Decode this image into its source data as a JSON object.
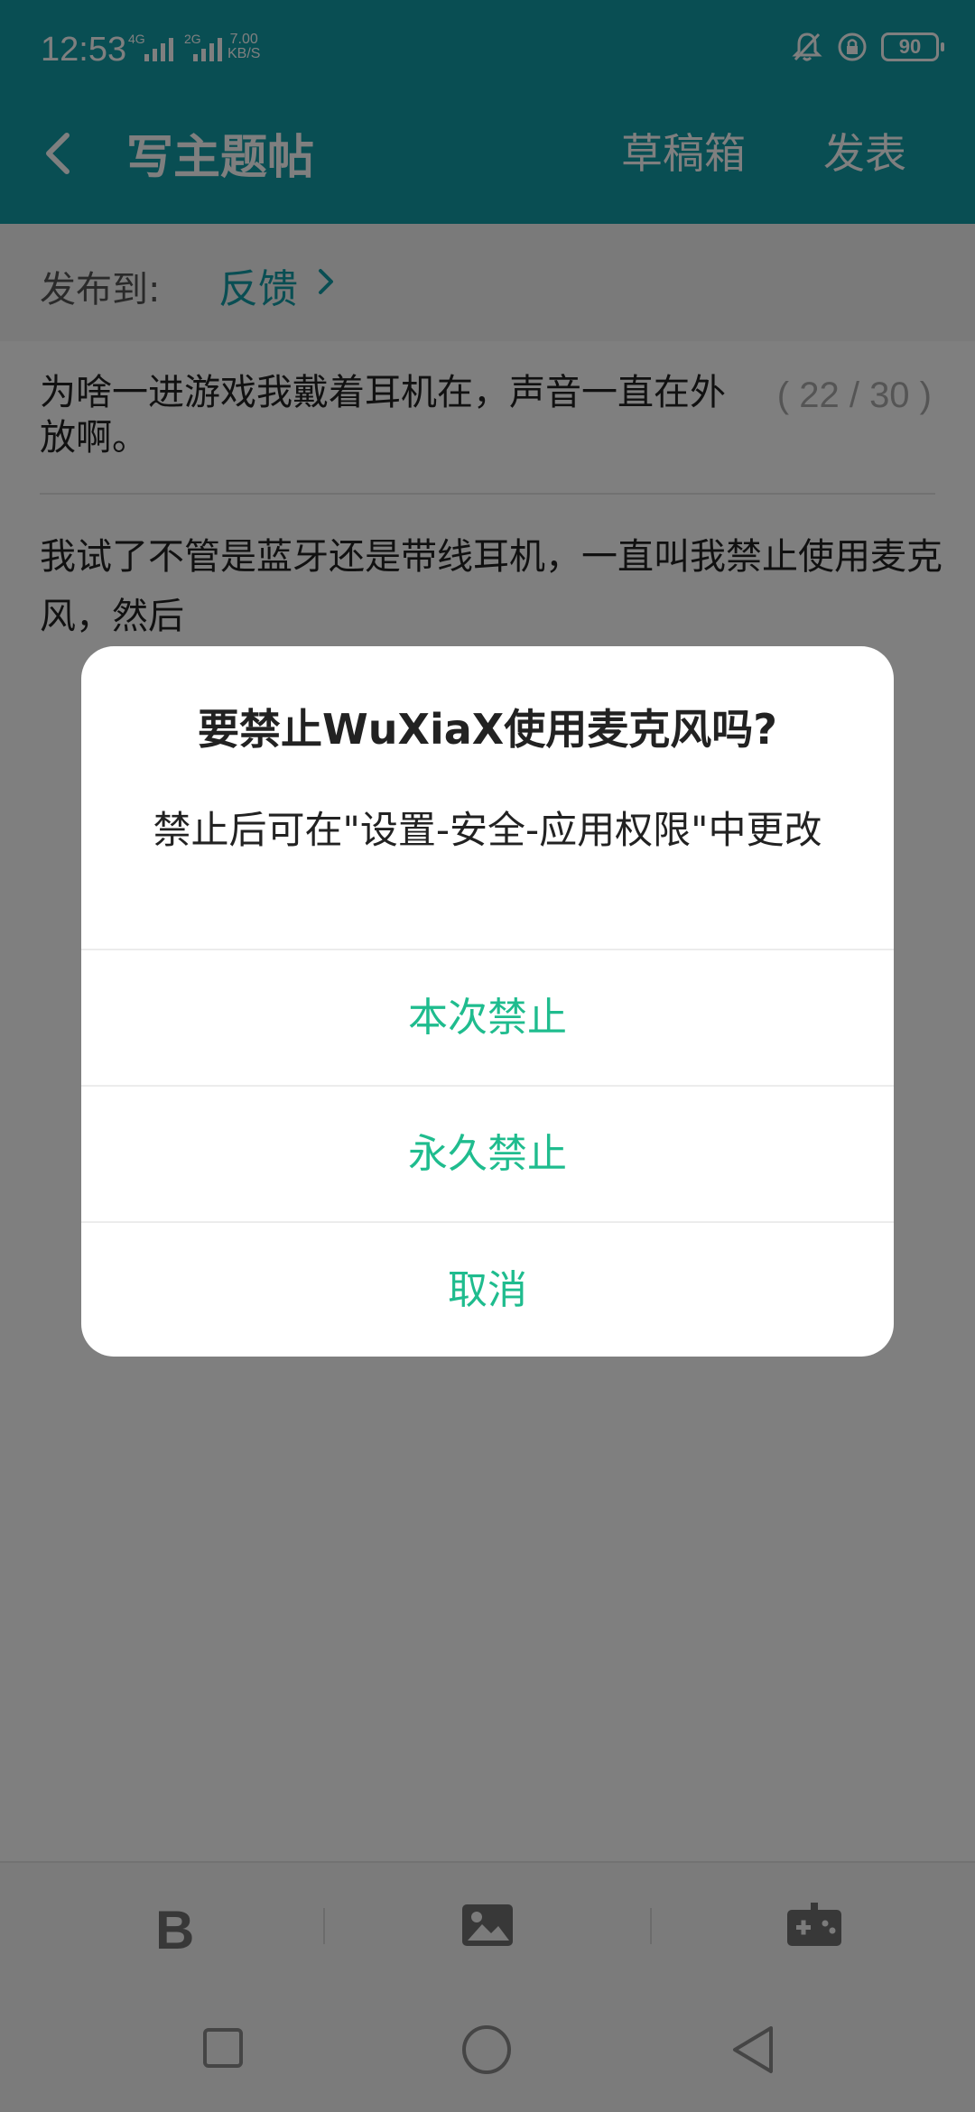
{
  "status_bar": {
    "time": "12:53",
    "net1": "4G",
    "net2": "2G",
    "speed_value": "7.00",
    "speed_unit": "KB/S",
    "battery": "90"
  },
  "app_bar": {
    "back_icon": "chevron-left-icon",
    "title": "写主题帖",
    "drafts_label": "草稿箱",
    "publish_label": "发表"
  },
  "publish_to": {
    "label": "发布到:",
    "target": "反馈"
  },
  "post": {
    "title": "为啥一进游戏我戴着耳机在，声音一直在外放啊。",
    "char_count": "( 22 / 30 )",
    "body": "我试了不管是蓝牙还是带线耳机，一直叫我禁止使用麦克风，然后"
  },
  "toolbar": {
    "bold": "B",
    "icons": [
      "bold-icon",
      "image-icon",
      "gamepad-icon"
    ]
  },
  "nav": {
    "icons": [
      "recents-square-icon",
      "home-circle-icon",
      "back-triangle-icon"
    ]
  },
  "dialog": {
    "title": "要禁止WuXiaX使用麦克风吗?",
    "message": "禁止后可在\"设置-安全-应用权限\"中更改",
    "buttons": [
      "本次禁止",
      "永久禁止",
      "取消"
    ],
    "accent_color": "#1fbc8e"
  },
  "colors": {
    "primary": "#129ca7",
    "dialog_button": "#1fbc8e"
  }
}
